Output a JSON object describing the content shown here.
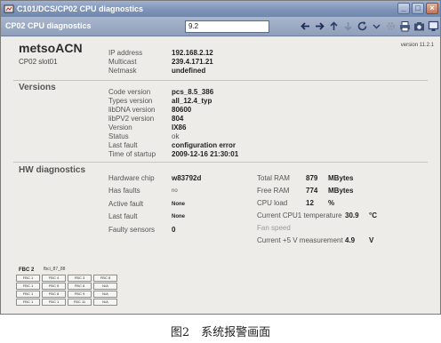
{
  "window": {
    "title": "C101/DCS/CP02 CPU diagnostics",
    "buttons": [
      "_",
      "□",
      "×"
    ]
  },
  "toolbar": {
    "page_name": "CP02 CPU diagnostics",
    "address_value": "9.2"
  },
  "header": {
    "hostname": "metsoACN",
    "cpu_slot": "CP02 slot01",
    "version": "version 11.2.1",
    "fields": [
      {
        "label": "IP address",
        "value": "192.168.2.12"
      },
      {
        "label": "Multicast",
        "value": "239.4.171.21"
      },
      {
        "label": "Netmask",
        "value": "undefined"
      }
    ]
  },
  "versions": {
    "title": "Versions",
    "fields": [
      {
        "label": "Code version",
        "value": "pcs_8.5_386"
      },
      {
        "label": "Types version",
        "value": "all_12.4_typ"
      },
      {
        "label": "libDNA version",
        "value": "80600"
      },
      {
        "label": "libPV2 version",
        "value": "804"
      },
      {
        "label": "Version",
        "value": "IX86"
      },
      {
        "label": "Status",
        "value": "ok"
      },
      {
        "label": "Last fault",
        "value": "configuration error"
      },
      {
        "label": "Time of startup",
        "value": "2009-12-16 21:30:01"
      }
    ]
  },
  "hw": {
    "title": "HW diagnostics",
    "left": [
      {
        "label": "Hardware chip",
        "value": "w83792d"
      },
      {
        "label": "Has faults",
        "value": "no"
      },
      {
        "label": "Active fault",
        "value": "None"
      },
      {
        "label": "Last fault",
        "value": "None"
      },
      {
        "label": "Faulty sensors",
        "value": "0"
      }
    ],
    "right": [
      {
        "label": "Total RAM",
        "value": "879",
        "unit": "MBytes"
      },
      {
        "label": "Free RAM",
        "value": "774",
        "unit": "MBytes"
      },
      {
        "label": "CPU load",
        "value": "12",
        "unit": "%"
      },
      {
        "label": "Current CPU1 temperature",
        "value": "30.9",
        "unit": "°C"
      },
      {
        "label": "Fan speed",
        "value": "",
        "unit": ""
      },
      {
        "label": "Current +5 V measurement",
        "value": "4.9",
        "unit": "V"
      }
    ]
  },
  "fbc": {
    "title": "FBC 2",
    "subtitle": "fbci_87_88",
    "cells": [
      "FBC 1",
      "FBC 4",
      "FBC 3",
      "FBC 8",
      "FBC 1",
      "FBC 5",
      "FBC 8",
      "N/A",
      "FBC 1",
      "FBC 8",
      "FBC 9",
      "N/A",
      "FBC 1",
      "FBC 1",
      "FBC 11",
      "N/A"
    ]
  },
  "caption": "图2　系统报警画面"
}
